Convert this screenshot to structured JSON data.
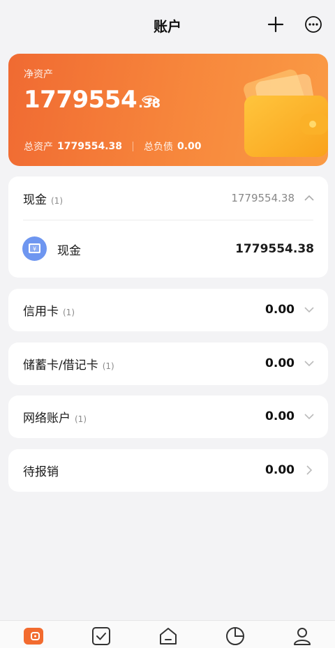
{
  "header": {
    "title": "账户",
    "icons": [
      "plus-icon",
      "more-icon"
    ]
  },
  "summary": {
    "net_label": "净资产",
    "net_int": "1779554",
    "net_dec": ".38",
    "total_assets_label": "总资产",
    "total_assets": "1779554.38",
    "total_liabilities_label": "总负债",
    "total_liabilities": "0.00",
    "gradient_colors": [
      "#f06a32",
      "#fa9b45"
    ]
  },
  "groups": [
    {
      "name": "现金",
      "count": "(1)",
      "amount": "1779554.38",
      "expanded": true,
      "items": [
        {
          "name": "现金",
          "amount": "1779554.38",
          "icon": "cash-yen-icon"
        }
      ]
    },
    {
      "name": "信用卡",
      "count": "(1)",
      "amount": "0.00",
      "expanded": false
    },
    {
      "name": "储蓄卡/借记卡",
      "count": "(1)",
      "amount": "0.00",
      "expanded": false
    },
    {
      "name": "网络账户",
      "count": "(1)",
      "amount": "0.00",
      "expanded": false
    },
    {
      "name": "待报销",
      "count": "",
      "amount": "0.00",
      "expanded": false
    }
  ],
  "tabbar": {
    "tabs": [
      "wallet-icon",
      "checklist-icon",
      "home-icon",
      "chart-icon",
      "profile-icon"
    ],
    "active": 0,
    "accent": "#f26b2f"
  }
}
